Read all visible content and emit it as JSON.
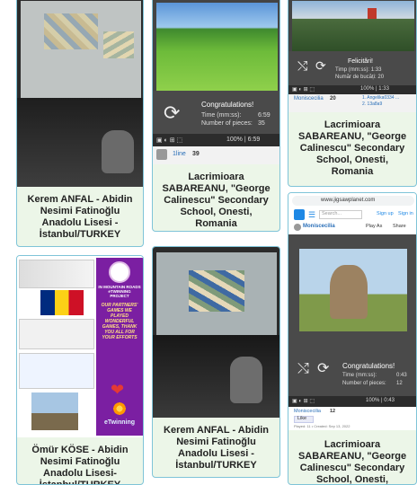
{
  "colors": {
    "card_bg": "#ecf6e8",
    "card_border": "#7fc4d8",
    "puzzle_bar": "#3a3a3a",
    "link_blue": "#2a6fb8"
  },
  "cards": {
    "c1": {
      "caption": "Kerem ANFAL - Abidin\nNesimi Fatinoğlu\nAnadolu Lisesi -\nİstanbul/TURKEY"
    },
    "c2": {
      "caption": "Lacrimioara\nSABAREANU, \"George\nCalinescu\" Secondary\nSchool, Onesti,\nRomania",
      "congrats": "Congratulations!",
      "time_label": "Time (mm:ss):",
      "time_value": "6:59",
      "pieces_label": "Number of pieces:",
      "pieces_value": "35",
      "progress": "100% | 6:59",
      "user": "1line",
      "count": "39"
    },
    "c3": {
      "caption": "Lacrimioara\nSABAREANU, \"George\nCalinescu\" Secondary\nSchool, Onesti,\nRomania",
      "felicitari": "Felicitări!",
      "time_small": "Timp (mm:ss): 1:33",
      "pieces_small": "Număr de bucăți: 20",
      "progress": "100% | 1:33",
      "user": "Moniscecilia",
      "count": "20",
      "list1": "1. Angelika0334 ...",
      "list2": "2. 13a8a9"
    },
    "c4": {
      "caption": "Ömür KÖSE - Abidin\nNesimi Fatinoğlu\nAnadolu Lisesi-\nİstanbul/TURKEY",
      "poster_title": "IN MOUNTAIN ROADS\neTWINNING\nPROJECT",
      "poster_text": "OUR PARTNERS'\nGAMES WE\nPLAYED\nWONDERFUL\nGAMES, THANK\nYOU ALL FOR\nYOUR EFFORTS",
      "etwinning": "eTwinning"
    },
    "c5": {
      "caption": "Kerem ANFAL - Abidin\nNesimi Fatinoğlu\nAnadolu Lisesi -\nİstanbul/TURKEY"
    },
    "c6": {
      "caption": "Lacrimioara\nSABAREANU, \"George\nCalinescu\" Secondary\nSchool, Onesti,\nRomania",
      "url": "www.jigsawplanet.com",
      "search_placeholder": "Search...",
      "signup": "Sign up",
      "signin": "Sign in",
      "user": "Moniscecilia",
      "play_as": "Play As",
      "share": "Share",
      "congrats": "Congratulations!",
      "time_label": "Time (mm:ss):",
      "time_value": "0:43",
      "pieces_label": "Number of pieces:",
      "pieces_value": "12",
      "progress": "100% | 0:43",
      "count": "12",
      "like": "Like",
      "footer": "Played: 11 • Created: Sep 13, 2022"
    }
  }
}
